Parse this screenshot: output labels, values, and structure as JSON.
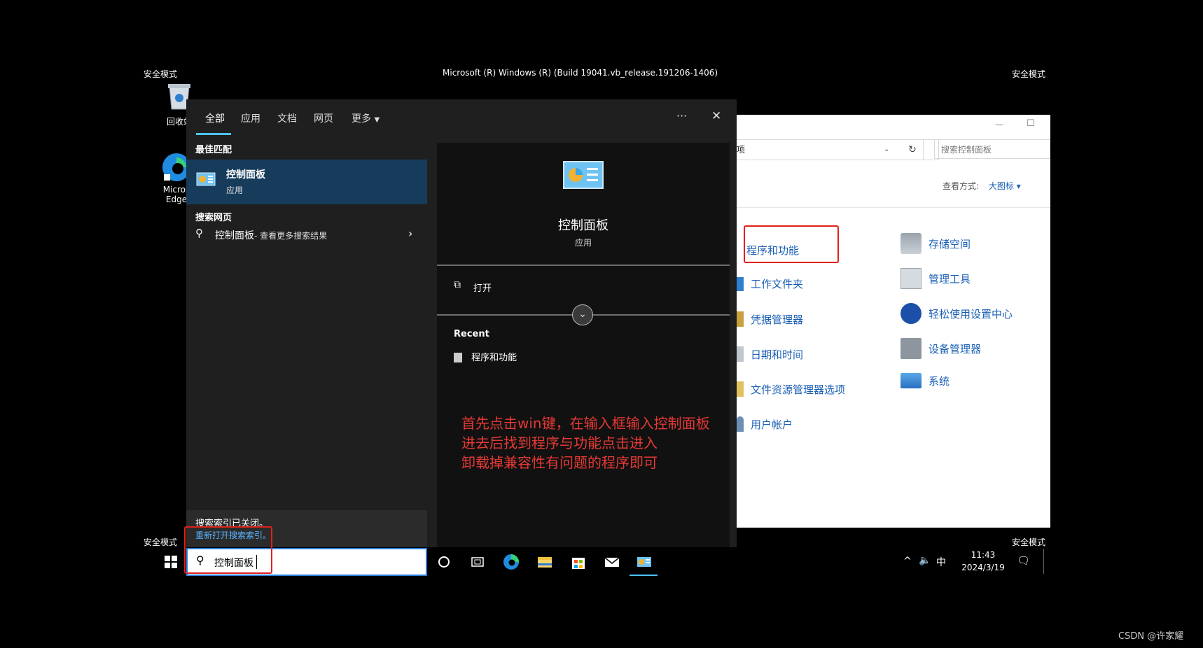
{
  "screen": {
    "build_text": "Microsoft (R) Windows (R) (Build 19041.vb_release.191206-1406)",
    "safe_mode": "安全模式",
    "watermark": "CSDN @许家耀"
  },
  "desktop": {
    "recycle_label": "回收站",
    "edge_label_1": "Micros",
    "edge_label_2": "Edge"
  },
  "search_panel": {
    "tabs": [
      "全部",
      "应用",
      "文档",
      "网页",
      "更多"
    ],
    "more_options": "···",
    "close": "✕",
    "best_match_title": "最佳匹配",
    "best_match": {
      "name": "控制面板",
      "type": "应用"
    },
    "web_title": "搜索网页",
    "web_result": {
      "query": "控制面板",
      "suffix": " - 查看更多搜索结果"
    },
    "index_notice": "搜索索引已关闭。",
    "index_link": "重新打开搜索索引。",
    "preview": {
      "name": "控制面板",
      "type": "应用",
      "open_label": "打开",
      "recent_title": "Recent",
      "recent_item": "程序和功能"
    }
  },
  "annotation": {
    "line1": "首先点击win键，在输入框输入控制面板",
    "line2": "进去后找到程序与功能点击进入",
    "line3": "卸载掉兼容性有问题的程序即可"
  },
  "control_panel": {
    "address_text": "项",
    "refresh": "↻",
    "search_placeholder": "搜索控制面板",
    "view_by_label": "查看方式:",
    "view_by_value": "大图标",
    "items_left": [
      "程序和功能",
      "工作文件夹",
      "凭据管理器",
      "日期和时间",
      "文件资源管理器选项",
      "用户帐户"
    ],
    "items_right": [
      "存储空间",
      "管理工具",
      "轻松使用设置中心",
      "设备管理器",
      "系统"
    ],
    "minimize": "—",
    "maximize": "☐"
  },
  "taskbar": {
    "search_value": "控制面板",
    "time": "11:43",
    "date": "2024/3/19",
    "ime": "中",
    "chevron": "^"
  },
  "colors": {
    "accent": "#4cc2ff",
    "annotation": "#e53935",
    "link": "#1a5fb4"
  }
}
